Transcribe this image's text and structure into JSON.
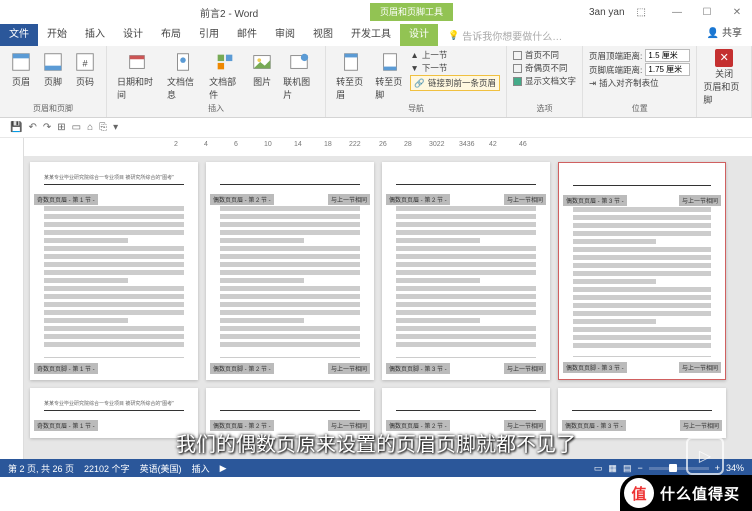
{
  "titlebar": {
    "doc": "前言2 - Word",
    "context": "页眉和页脚工具",
    "user": "3an yan"
  },
  "tabs": {
    "file": "文件",
    "list": [
      "开始",
      "插入",
      "设计",
      "布局",
      "引用",
      "邮件",
      "审阅",
      "视图",
      "开发工具"
    ],
    "active": "设计",
    "help": "告诉我你想要做什么…",
    "share": "共享"
  },
  "ribbon": {
    "g1": {
      "label": "页眉和页脚",
      "b1": "页眉",
      "b2": "页脚",
      "b3": "页码"
    },
    "g2": {
      "label": "插入",
      "b1": "日期和时间",
      "b2": "文档信息",
      "b3": "文档部件",
      "b4": "图片",
      "b5": "联机图片"
    },
    "g3": {
      "label": "导航",
      "b1": "转至页眉",
      "b2": "转至页脚",
      "i1": "上一节",
      "i2": "下一节",
      "i3": "链接到前一条页眉"
    },
    "g4": {
      "label": "选项",
      "i1": "首页不同",
      "i2": "奇偶页不同",
      "i3": "显示文档文字"
    },
    "g5": {
      "label": "位置",
      "i1": "页眉顶端距离:",
      "v1": "1.5 厘米",
      "i2": "页脚底端距离:",
      "v2": "1.75 厘米",
      "i3": "插入对齐制表位"
    },
    "g6": {
      "label": "关闭",
      "b1": "关闭",
      "b2": "页眉和页脚"
    }
  },
  "ruler": {
    "marks": [
      "2",
      "4",
      "6",
      "10",
      "14",
      "18",
      "222",
      "26",
      "28",
      "3022",
      "3436",
      "42",
      "46"
    ]
  },
  "pages": [
    {
      "hdr": "某某专业毕业研究院综合一专业项目 被研究所综合的\"图考\"",
      "tag1": "奇数页页眉 - 第 1 节 -",
      "ftr1": "奇数页页脚 - 第 1 节 -"
    },
    {
      "hdr": "",
      "tag1": "偶数页页眉 - 第 2 节 -",
      "tag2": "与上一节相同",
      "ftr1": "偶数页页脚 - 第 2 节 -",
      "ftr2": "与上一节相同"
    },
    {
      "hdr": "",
      "tag1": "偶数页页眉 - 第 2 节 -",
      "tag2": "与上一节相同",
      "ftr1": "偶数页页脚 - 第 3 节 -",
      "ftr2": "与上一节相同"
    },
    {
      "hdr": "",
      "tag1": "偶数页页眉 - 第 3 节 -",
      "tag2": "与上一节相同",
      "ftr1": "偶数页页脚 - 第 3 节 -",
      "ftr2": "与上一节相同",
      "hl": true
    }
  ],
  "subtitle": "我们的偶数页原来设置的页眉页脚就都不见了",
  "status": {
    "page": "第 2 页, 共 26 页",
    "words": "22102 个字",
    "lang": "英语(美国)",
    "mode": "插入",
    "zoom": "34%"
  },
  "badge": {
    "char": "值",
    "text": "什么值得买"
  }
}
